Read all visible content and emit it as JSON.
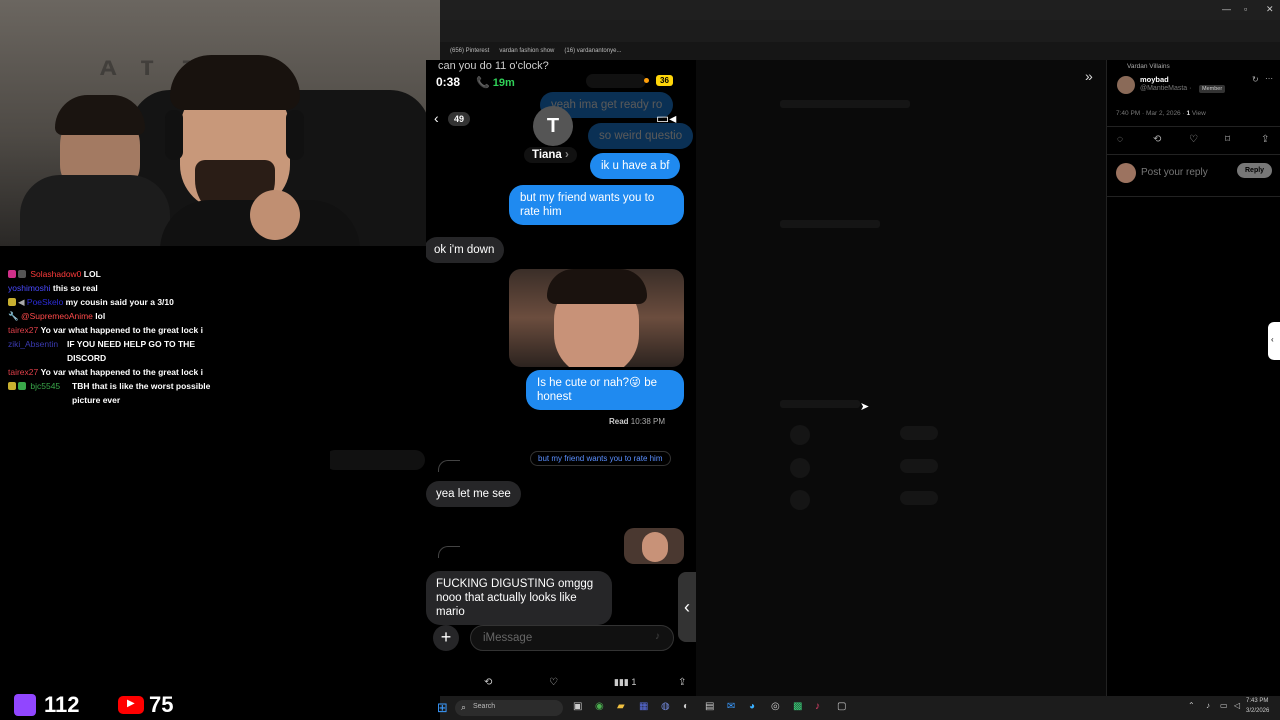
{
  "browser": {
    "bookmarks": [
      "(656) Pinterest",
      "vardan fashion show",
      "(16) vardanantonye..."
    ]
  },
  "chat": [
    {
      "user": "Solashadow0",
      "user_color": "#ff3b3b",
      "text": "LOL"
    },
    {
      "user": "yoshimoshi",
      "user_color": "#4a4aff",
      "text": "this so real"
    },
    {
      "user": "PoeSkelo",
      "user_color": "#2b2bd6",
      "text": "my cousin said your a 3/10"
    },
    {
      "user": "@SupremeoAnime",
      "user_color": "#ff4a4a",
      "text": "lol"
    },
    {
      "user": "tairex27",
      "user_color": "#e0404a",
      "text": "Yo var what happened to the great lock i"
    },
    {
      "user": "ziki_Absentin",
      "user_color": "#3a3ab0",
      "text": "IF YOU NEED HELP GO TO THE DISCORD"
    },
    {
      "user": "tairex27",
      "user_color": "#e0404a",
      "text": "Yo var what happened to the great lock i"
    },
    {
      "user": "bjc5545",
      "user_color": "#3aa84a",
      "text": "TBH that is like the worst possible picture ever"
    }
  ],
  "phone": {
    "time": "0:38",
    "call_time": "19m",
    "battery": "36",
    "back_count": "49",
    "contact_initial": "T",
    "contact_name": "Tiana",
    "top_text": "can you do 11 o'clock?",
    "faded_1": "yeah ima get ready ro",
    "faded_2": "so weird questio",
    "m1": "ik u have a bf",
    "m2": "but my friend wants you to rate him",
    "m3": "ok i'm down",
    "m4": "Is he cute or nah?😜 be honest",
    "read_label": "Read",
    "read_time": "10:38 PM",
    "reply_quote": "but my friend wants you to rate him",
    "m5": "yea let me see",
    "m6": "FUCKING DIGUSTING omggg nooo that actually looks like mario",
    "input_placeholder": "iMessage",
    "stat_views": "1"
  },
  "right": {
    "community": "Vardan Villains",
    "name": "moybad",
    "handle": "@MantieMasta ·",
    "member_badge": "Member",
    "timestamp": "7:40 PM · Mar 2, 2026 ·",
    "views": "1",
    "views_label": "View",
    "reply_placeholder": "Post your reply",
    "reply_btn": "Reply"
  },
  "stats": {
    "twitch": "112",
    "youtube": "75",
    "twitch_color": "#9146ff",
    "youtube_color": "#ff0000"
  },
  "taskbar": {
    "search": "Search",
    "time": "7:43 PM",
    "date": "3/2/2026"
  }
}
